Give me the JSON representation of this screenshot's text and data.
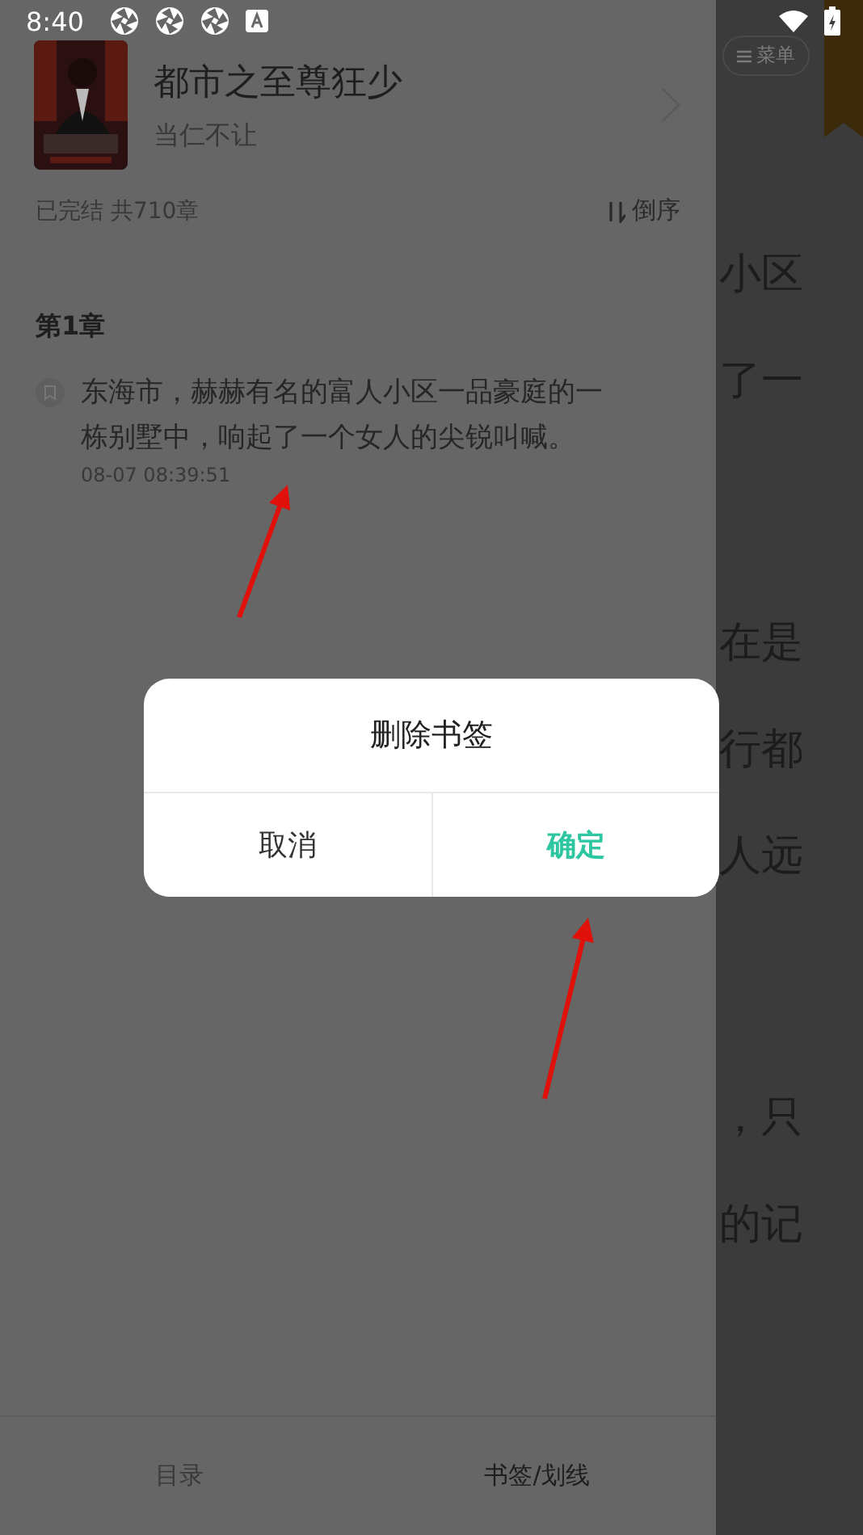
{
  "status_bar": {
    "time": "8:40"
  },
  "book": {
    "title": "都市之至尊狂少",
    "author": "当仁不让",
    "status": "已完结 共710章",
    "sort": "倒序"
  },
  "chapter": {
    "title": "第1章",
    "bookmarks": [
      {
        "text": "东海市，赫赫有名的富人小区一品豪庭的一栋别墅中，响起了一个女人的尖锐叫喊。",
        "time": "08-07 08:39:51"
      }
    ]
  },
  "tabs": [
    {
      "label": "目录",
      "selected": false
    },
    {
      "label": "书签/划线",
      "selected": true
    }
  ],
  "reader": {
    "menu": "菜单",
    "lines": [
      {
        "text": "小区",
        "gap": false
      },
      {
        "text": "了一",
        "gap": false
      },
      {
        "text": "在是",
        "gap": true
      },
      {
        "text": "行都",
        "gap": false
      },
      {
        "text": "人远",
        "gap": false
      },
      {
        "text": "，只",
        "gap": true
      },
      {
        "text": "的记",
        "gap": false
      }
    ]
  },
  "dialog": {
    "title": "删除书签",
    "buttons": [
      {
        "label": "取消",
        "primary": false
      },
      {
        "label": "确定",
        "primary": true
      }
    ]
  }
}
